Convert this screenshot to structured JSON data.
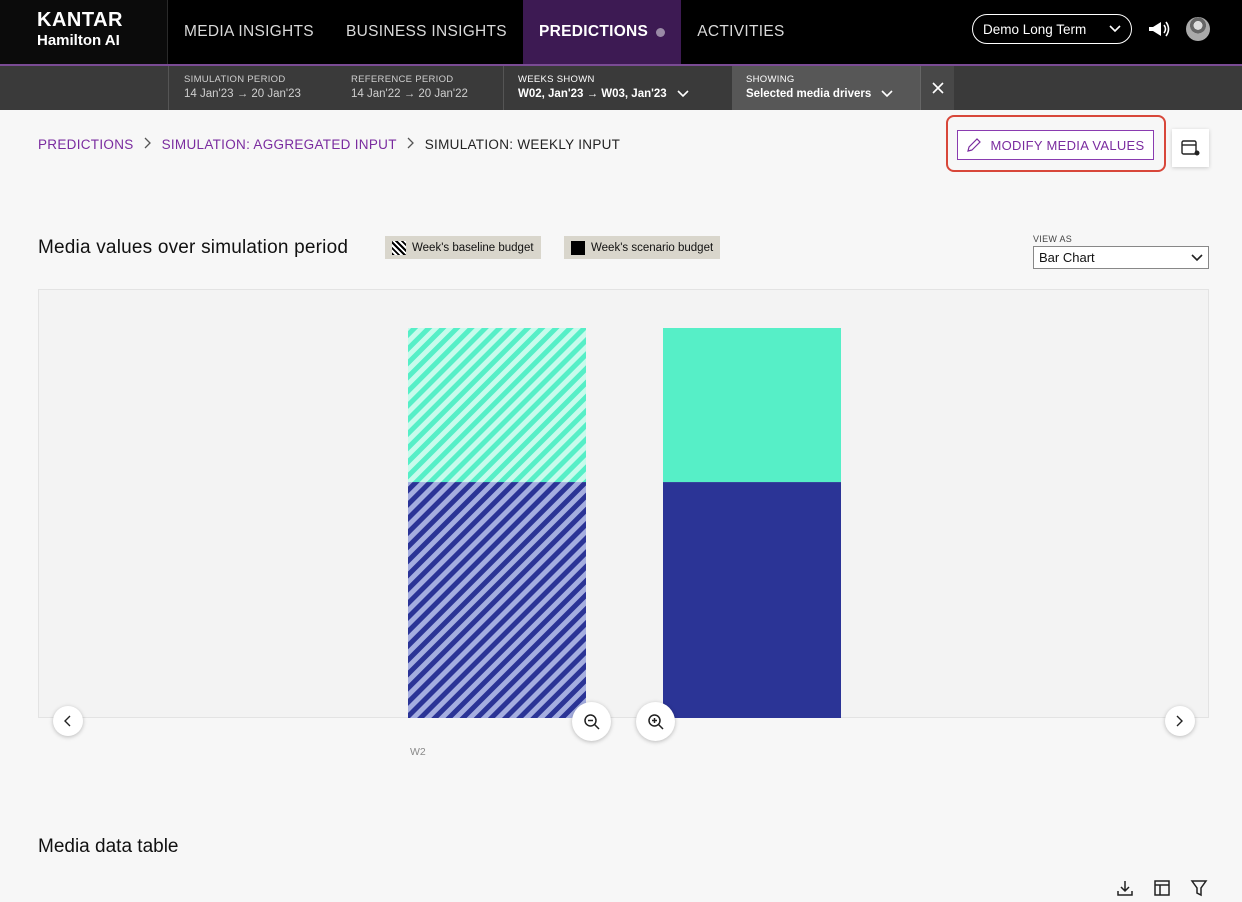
{
  "brand": {
    "line1": "KANTAR",
    "line2": "Hamilton AI"
  },
  "nav": {
    "items": [
      {
        "label": "MEDIA INSIGHTS"
      },
      {
        "label": "BUSINESS INSIGHTS"
      },
      {
        "label": "PREDICTIONS"
      },
      {
        "label": "ACTIVITIES"
      }
    ],
    "project": "Demo Long Term"
  },
  "subbar": {
    "simulation_period": {
      "label": "SIMULATION PERIOD",
      "value": "14 Jan'23 → 20 Jan'23"
    },
    "reference_period": {
      "label": "REFERENCE PERIOD",
      "value": "14 Jan'22 → 20 Jan'22"
    },
    "weeks_shown": {
      "label": "WEEKS SHOWN",
      "value": "W02, Jan'23 → W03, Jan'23"
    },
    "showing": {
      "label": "SHOWING",
      "value": "Selected media drivers"
    }
  },
  "breadcrumb": {
    "items": [
      "PREDICTIONS",
      "SIMULATION: AGGREGATED INPUT"
    ],
    "current": "SIMULATION: WEEKLY INPUT"
  },
  "actions": {
    "modify": "MODIFY MEDIA VALUES"
  },
  "chart_section": {
    "title": "Media values over simulation period",
    "legend": [
      "Week's baseline budget",
      "Week's scenario budget"
    ],
    "view_as_label": "VIEW AS",
    "view_as_value": "Bar Chart"
  },
  "chart_data": {
    "type": "bar",
    "stacked": true,
    "categories": [
      "W2"
    ],
    "series": [
      {
        "group": "baseline",
        "pattern": "hatched",
        "segments": [
          {
            "color": "#2b3496",
            "value": 60.5
          },
          {
            "color": "#56efc7",
            "value": 39.5
          }
        ]
      },
      {
        "group": "scenario",
        "pattern": "solid",
        "segments": [
          {
            "color": "#2b3496",
            "value": 60.5
          },
          {
            "color": "#56efc7",
            "value": 39.5
          }
        ]
      }
    ],
    "ylim": [
      0,
      100
    ],
    "grid": false
  },
  "colors": {
    "accent": "#7a2b9f",
    "highlight": "#d8473a",
    "navy": "#2b3496",
    "mint": "#56efc7"
  },
  "table_section": {
    "title": "Media data table"
  }
}
